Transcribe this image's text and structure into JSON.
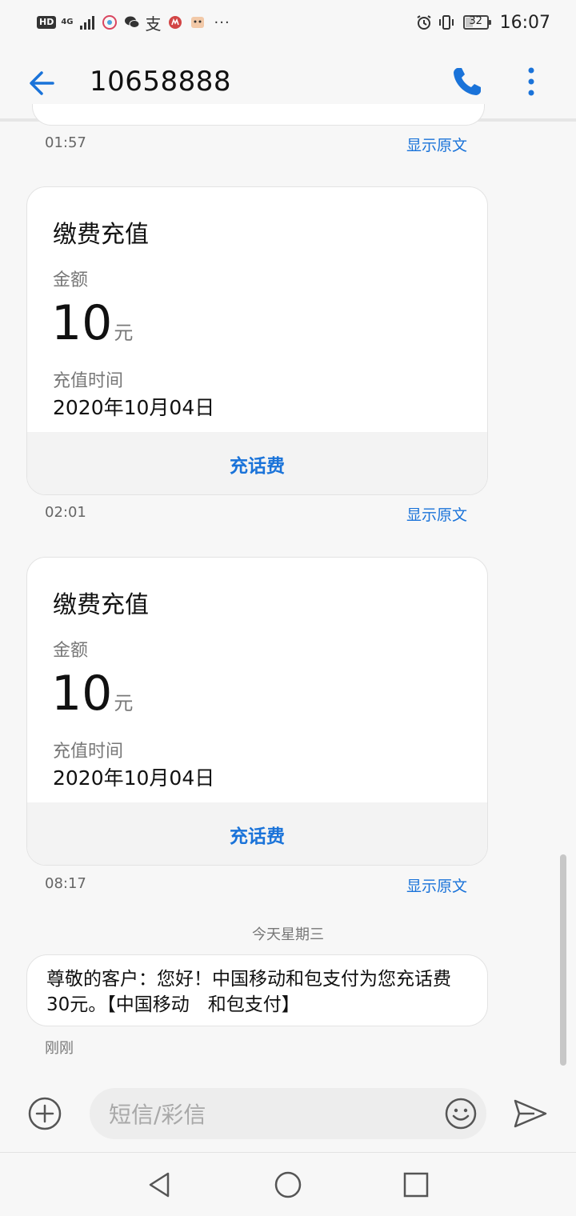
{
  "status_bar": {
    "hd": "HD",
    "network": "4G",
    "time": "16:07",
    "battery": "32",
    "battery_level_percent": 32,
    "overflow": "···",
    "alipay_glyph": "支"
  },
  "header": {
    "title": "10658888"
  },
  "messages": {
    "prev_time": "01:57",
    "prev_link": "显示原文",
    "cards": [
      {
        "title": "缴费充值",
        "amount_label": "金额",
        "amount": "10",
        "amount_unit": "元",
        "date_label": "充值时间",
        "date": "2020年10月04日",
        "action": "充话费",
        "time": "02:01",
        "link": "显示原文"
      },
      {
        "title": "缴费充值",
        "amount_label": "金额",
        "amount": "10",
        "amount_unit": "元",
        "date_label": "充值时间",
        "date": "2020年10月04日",
        "action": "充话费",
        "time": "08:17",
        "link": "显示原文"
      }
    ],
    "day_divider": "今天星期三",
    "latest": {
      "text": "尊敬的客户：您好！中国移动和包支付为您充话费30元。【中国移动　和包支付】",
      "time": "刚刚"
    }
  },
  "composer": {
    "placeholder": "短信/彩信"
  },
  "colors": {
    "accent": "#1a73d9",
    "background": "#f7f7f7",
    "card": "#ffffff",
    "action_bg": "#f3f3f3"
  }
}
